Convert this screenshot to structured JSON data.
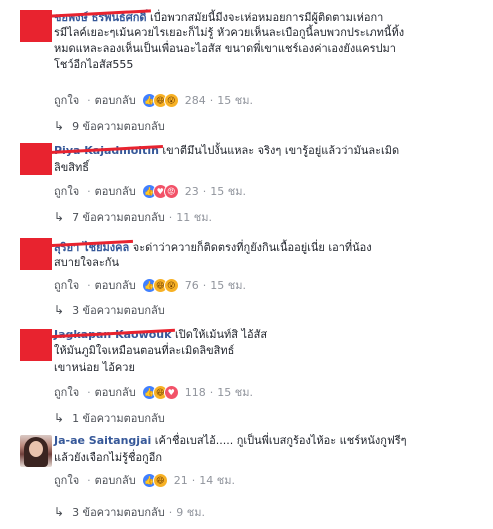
{
  "comments": [
    {
      "name": "ชยพงษ์ ธรพันธ์ศกดิ์",
      "lines": [
        "เบื่อพวกสมัยนี้มีงจะเห่อหมอยการมีผู้ติดตามเห่อกา",
        "รมีไลค์เยอะๆเม้นควยไรเยอะก็ไม่รู้ หัวควยเห็นละเบือกูนี้ลบพวกประเภทนี้ทิ้ง",
        "หมดแหละลองเห็นเป็นเพื่อนอะไอสัส ขนาดพี่เขาแชร์เองค่าเองยังแครปมา",
        "โชว์อีกไอสัส555"
      ],
      "like_label": "ถูกใจ",
      "reply_label": "ตอบกลับ",
      "reactions": [
        "like",
        "haha",
        "wow"
      ],
      "reaction_count": "284",
      "time": "15 ชม.",
      "replies_label": "9 ข้อความตอบกลับ"
    },
    {
      "name": "Piya Kajadmoltin",
      "lines": [
        "เขาตีมึนไปงั้นแหละ จริงๆ เขารู้อยู่แล้วว่ามันละเมิด",
        "ลิขสิทธิ์"
      ],
      "like_label": "ถูกใจ",
      "reply_label": "ตอบกลับ",
      "reactions": [
        "like",
        "love",
        "angry"
      ],
      "reaction_count": "23",
      "time": "15 ชม.",
      "reply_more": "7 ข้อความตอบกลับ",
      "reply_time": "11 ชม."
    },
    {
      "name": "สุริยา ไชยมงคล",
      "lines": [
        "จะด่าว่าควายก็ติดตรงที่กูยังกินเนื้ออยู่เนี่ย เอาที่น้อง",
        "สบายใจละกัน"
      ],
      "like_label": "ถูกใจ",
      "reply_label": "ตอบกลับ",
      "reactions": [
        "like",
        "haha",
        "wow"
      ],
      "reaction_count": "76",
      "time": "15 ชม.",
      "replies_label": "3 ข้อความตอบกลับ"
    },
    {
      "name": "Jagkapan Kaowouk",
      "lines": [
        "เปิดให้เม้นท์สิ ไอ้สัส",
        "ให้มันภูมิใจเหมือนตอนที่ละเมิดลิขสิทธ์",
        "เขาหน่อย ไอ้ควย"
      ],
      "like_label": "ถูกใจ",
      "reply_label": "ตอบกลับ",
      "reactions": [
        "like",
        "haha",
        "love"
      ],
      "reaction_count": "118",
      "time": "15 ชม.",
      "replies_label": "1 ข้อความตอบกลับ"
    },
    {
      "name": "Ja-ae Saitangjai",
      "lines": [
        "เค้าชื่อเบสไอ้..... กูเป็นพี่เบสกูร้องไห้อะ แชร์หนังกูฟรีๆ",
        "แล้วยังเจือกไม่รู้ชื่อกูอีก"
      ],
      "like_label": "ถูกใจ",
      "reply_label": "ตอบกลับ",
      "reactions": [
        "like",
        "haha"
      ],
      "reaction_count": "21",
      "time": "14 ชม.",
      "reply_more": "3 ข้อความตอบกลับ",
      "reply_time": "9 ชม."
    }
  ],
  "colors": {
    "name": "#365899",
    "redaction": "#e8232f",
    "meta": "#90949c"
  }
}
